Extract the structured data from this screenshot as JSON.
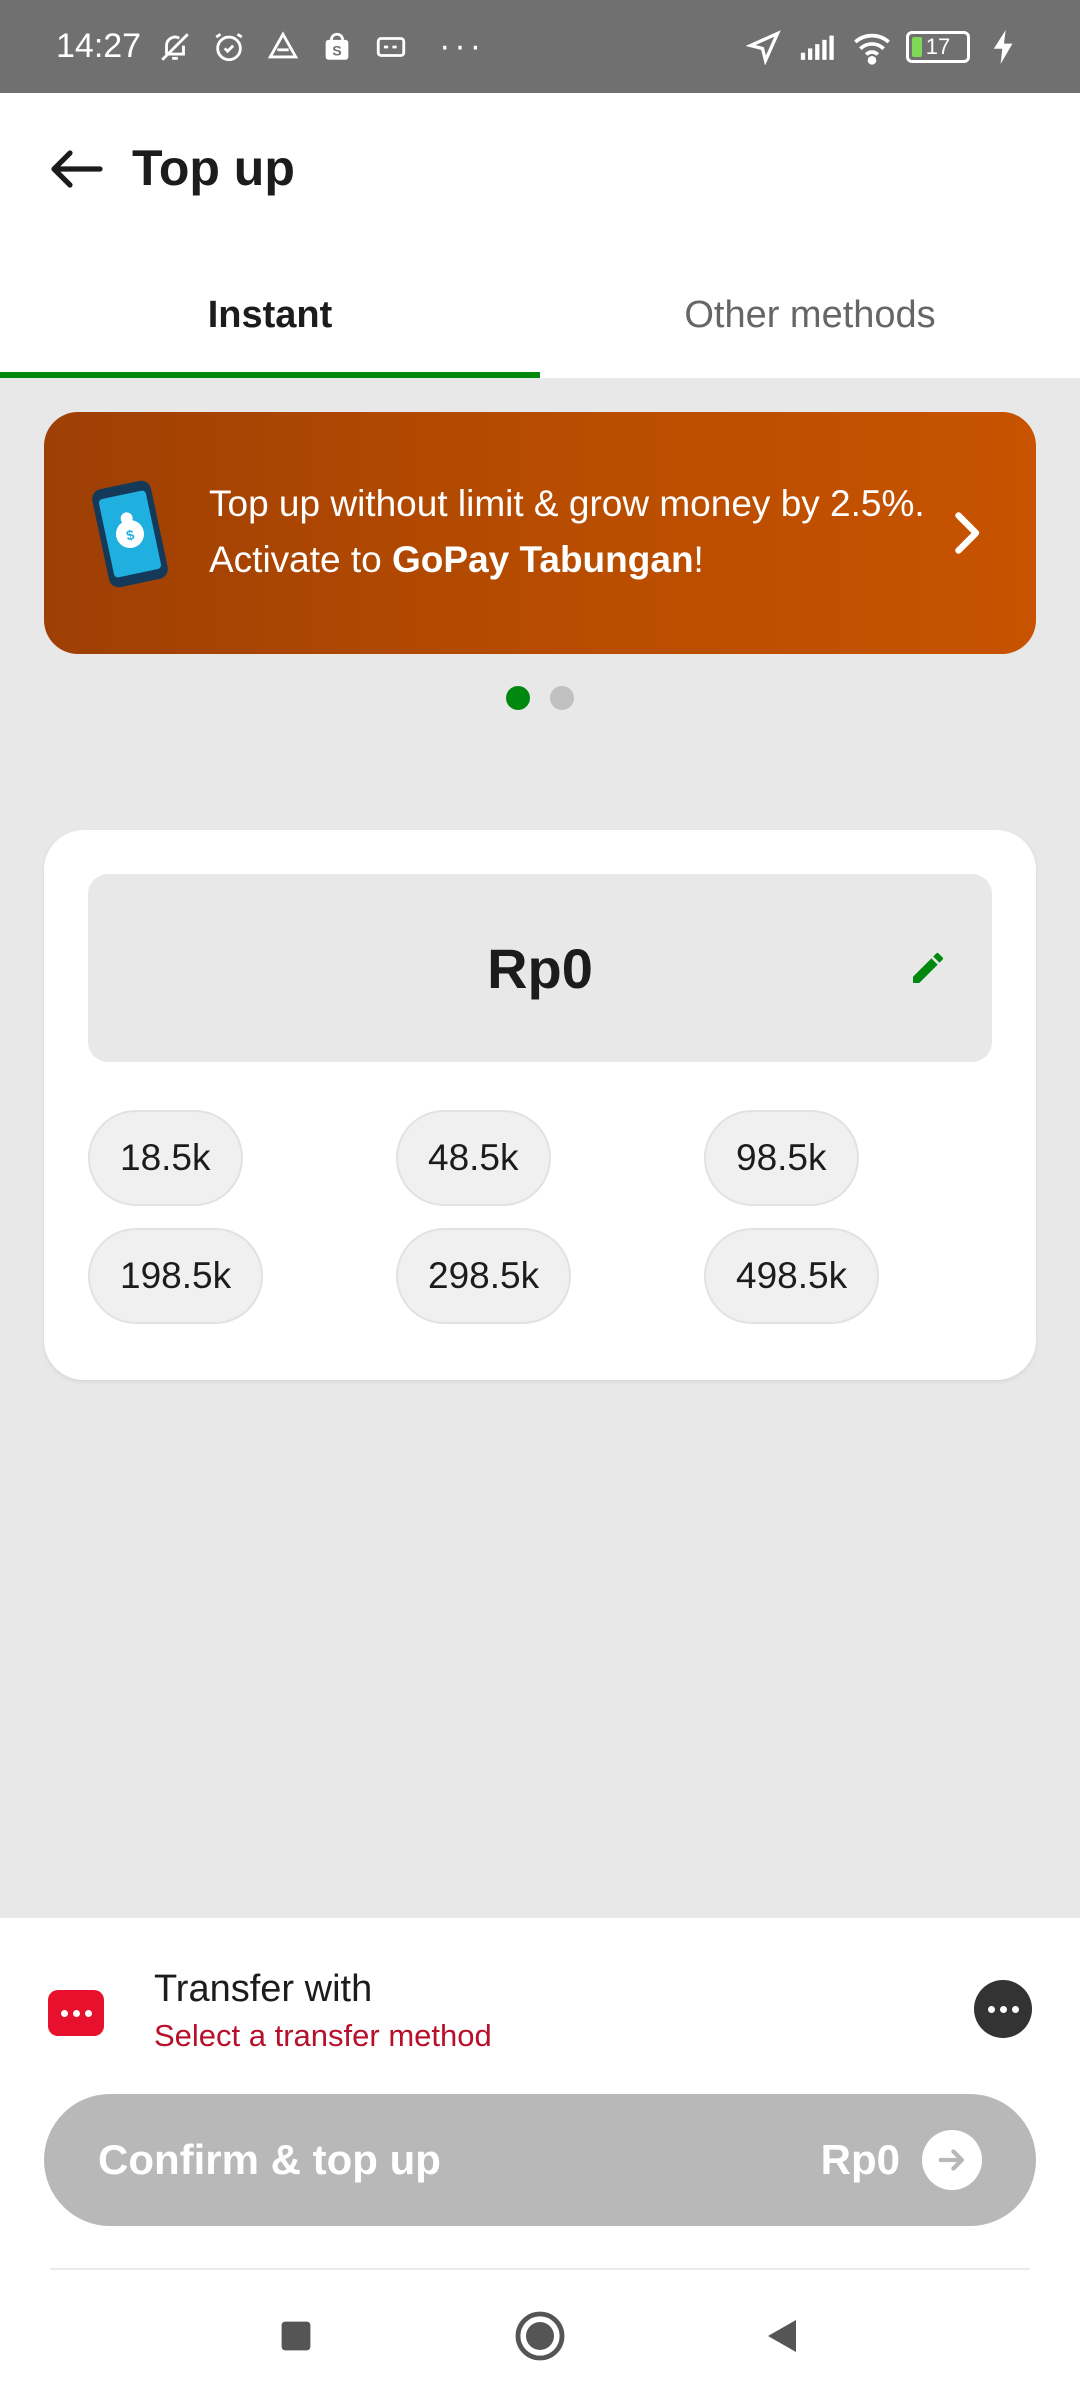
{
  "status_bar": {
    "time": "14:27",
    "more_indicator": "···",
    "battery_level": "17",
    "icons": [
      "bell-off-icon",
      "alarm-icon",
      "drive-icon",
      "shop-icon",
      "card-icon",
      "location-icon",
      "signal-icon",
      "wifi-icon",
      "battery-icon",
      "charging-icon"
    ]
  },
  "header": {
    "title": "Top up",
    "back_icon": "back-arrow-icon"
  },
  "tabs": [
    {
      "label": "Instant",
      "active": true
    },
    {
      "label": "Other methods",
      "active": false
    }
  ],
  "banner": {
    "text_before": "Top up without limit & grow money by 2.5%. Activate to ",
    "text_bold": "GoPay Tabungan",
    "text_after": "!",
    "colors": [
      "#9e3f05",
      "#c75300"
    ]
  },
  "carousel": {
    "total": 2,
    "active_index": 0
  },
  "amount": {
    "value": "Rp0",
    "presets": [
      "18.5k",
      "48.5k",
      "98.5k",
      "198.5k",
      "298.5k",
      "498.5k"
    ]
  },
  "transfer": {
    "title": "Transfer with",
    "subtitle": "Select a transfer method"
  },
  "confirm": {
    "label": "Confirm & top up",
    "amount": "Rp0"
  },
  "colors": {
    "accent": "#00880f",
    "error": "#b8102a",
    "disabled": "#b8b8b8"
  }
}
